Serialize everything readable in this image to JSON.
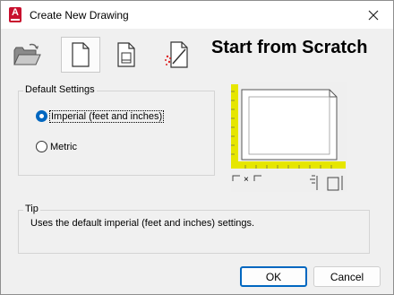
{
  "window": {
    "title": "Create New Drawing",
    "app_icon_letter": "A"
  },
  "toolbar": {
    "items": [
      {
        "name": "open-drawing",
        "icon": "folder-open-icon"
      },
      {
        "name": "start-from-scratch",
        "icon": "blank-page-icon",
        "active": true
      },
      {
        "name": "use-template",
        "icon": "template-page-icon"
      },
      {
        "name": "use-wizard",
        "icon": "wizard-icon"
      }
    ],
    "heading": "Start from Scratch"
  },
  "default_settings": {
    "label": "Default Settings",
    "options": [
      {
        "label": "Imperial (feet and inches)",
        "selected": true
      },
      {
        "label": "Metric",
        "selected": false
      }
    ]
  },
  "preview": {
    "x_label": "×"
  },
  "tip": {
    "label": "Tip",
    "text": "Uses the default imperial (feet and inches) settings."
  },
  "buttons": {
    "ok": "OK",
    "cancel": "Cancel"
  },
  "colors": {
    "accent": "#0067c0",
    "ruler": "#e6e600",
    "app_icon": "#c8102e"
  }
}
